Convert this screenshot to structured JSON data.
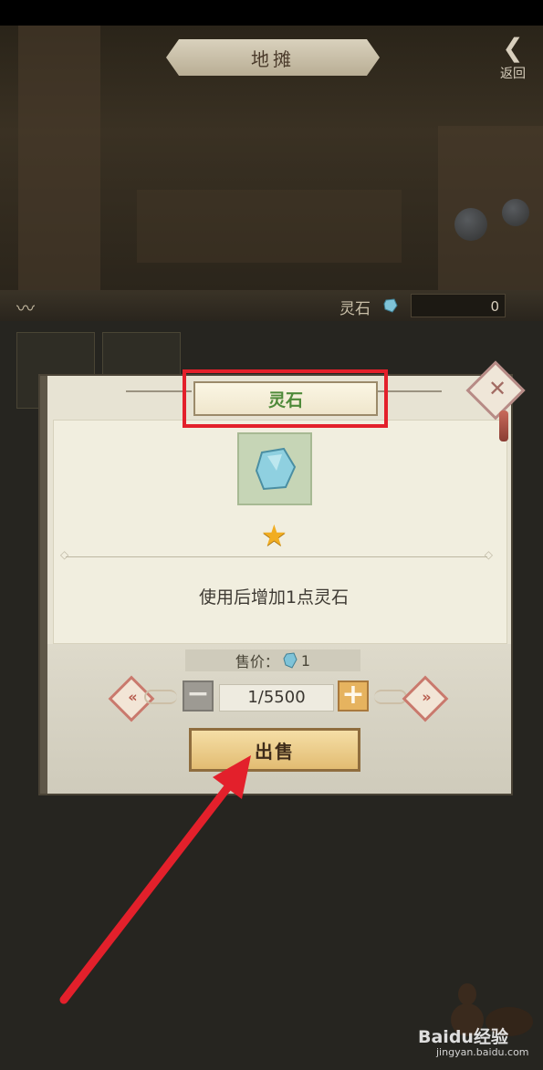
{
  "header": {
    "title": "地摊",
    "back_label": "返回"
  },
  "currency": {
    "label": "灵石",
    "value": "0",
    "icon": "spirit-stone-icon"
  },
  "dialog": {
    "item_name": "灵石",
    "item_icon": "spirit-stone-icon",
    "rating_icon": "star-icon",
    "description": "使用后增加1点灵石",
    "price_label": "售价：",
    "price_value": "1",
    "quantity": "1/5500",
    "sell_label": "出售",
    "minus_icon": "minus-icon",
    "plus_icon": "plus-icon"
  },
  "watermark": {
    "brand": "Baidu经验",
    "url": "jingyan.baidu.com"
  },
  "colors": {
    "highlight": "#e3202b",
    "arrow": "#e3202b",
    "item_name": "#4f8a3a",
    "star": "#f1ad22"
  }
}
